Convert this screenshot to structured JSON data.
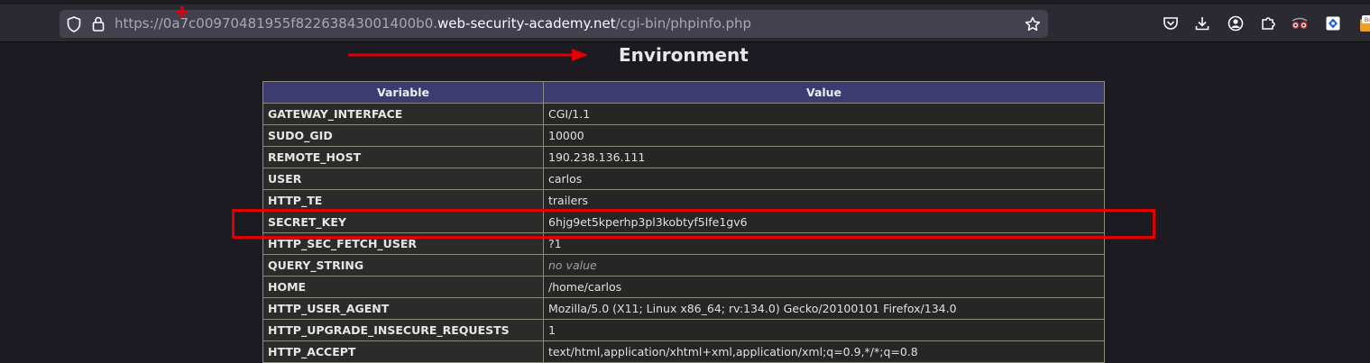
{
  "browser": {
    "url_prefix": "https://",
    "url_sub": "0a7c00970481955f82263843001400b0.",
    "url_domain": "web-security-academy.net",
    "url_path": "/cgi-bin/phpinfo.php",
    "icons": [
      "shield-icon",
      "lock-icon",
      "star-icon",
      "pocket-icon",
      "download-icon",
      "account-icon",
      "extensions-icon",
      "spy-glasses-icon",
      "burp-extension-icon",
      "bug-extension-icon"
    ]
  },
  "page": {
    "heading": "Environment",
    "table": {
      "headers": [
        "Variable",
        "Value"
      ],
      "rows": [
        {
          "name": "GATEWAY_INTERFACE",
          "value": "CGI/1.1"
        },
        {
          "name": "SUDO_GID",
          "value": "10000"
        },
        {
          "name": "REMOTE_HOST",
          "value": "190.238.136.111"
        },
        {
          "name": "USER",
          "value": "carlos"
        },
        {
          "name": "HTTP_TE",
          "value": "trailers"
        },
        {
          "name": "SECRET_KEY",
          "value": "6hjg9et5kperhp3pl3kobtyf5lfe1gv6"
        },
        {
          "name": "HTTP_SEC_FETCH_USER",
          "value": "?1"
        },
        {
          "name": "QUERY_STRING",
          "value": "no value"
        },
        {
          "name": "HOME",
          "value": "/home/carlos"
        },
        {
          "name": "HTTP_USER_AGENT",
          "value": "Mozilla/5.0 (X11; Linux x86_64; rv:134.0) Gecko/20100101 Firefox/134.0"
        },
        {
          "name": "HTTP_UPGRADE_INSECURE_REQUESTS",
          "value": "1"
        },
        {
          "name": "HTTP_ACCEPT",
          "value": "text/html,application/xhtml+xml,application/xml;q=0.9,*/*;q=0.8"
        }
      ]
    }
  },
  "annotations": {
    "color": "#e00000",
    "highlighted_row": "SECRET_KEY"
  }
}
